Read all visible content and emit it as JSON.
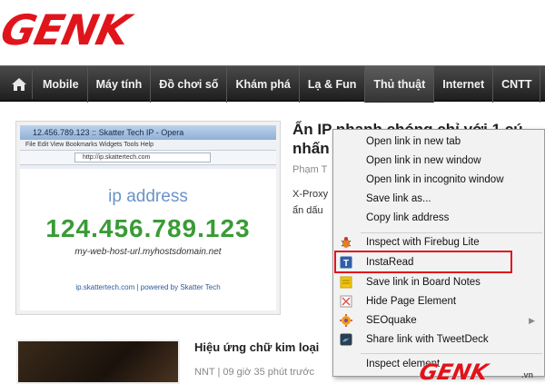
{
  "logo": {
    "text": "GENK"
  },
  "nav": {
    "items": [
      "Mobile",
      "Máy tính",
      "Đồ chơi số",
      "Khám phá",
      "Lạ & Fun",
      "Thủ thuật",
      "Internet",
      "CNTT"
    ],
    "active": "Thủ thuật"
  },
  "article1": {
    "thumb": {
      "window_title": "12.456.789.123 :: Skatter Tech IP - Opera",
      "menu": "File   Edit   View   Bookmarks   Widgets   Tools   Help",
      "address": "http://ip.skattertech.com",
      "label": "ip address",
      "ip": "124.456.789.123",
      "host": "my-web-host-url.myhostsdomain.net",
      "powered": "ip.skattertech.com  |  powered by Skatter Tech"
    },
    "title_line1": "Ẩn IP nhanh chóng chỉ với 1 cú",
    "title_line2": "nhấn",
    "meta": "Phạm T",
    "body_line1": "X-Proxy",
    "body_line2": "ẩn dấu"
  },
  "article2": {
    "title": "Hiệu ứng chữ kim loại",
    "meta": "NNT | 09 giờ 35 phút trước"
  },
  "context_menu": {
    "items": [
      {
        "label": "Open link in new tab",
        "icon": ""
      },
      {
        "label": "Open link in new window",
        "icon": ""
      },
      {
        "label": "Open link in incognito window",
        "icon": ""
      },
      {
        "label": "Save link as...",
        "icon": ""
      },
      {
        "label": "Copy link address",
        "icon": ""
      },
      {
        "label": "Inspect with Firebug Lite",
        "icon": "firebug-icon"
      },
      {
        "label": "InstaRead",
        "icon": "instaread-icon"
      },
      {
        "label": "Save link in Board Notes",
        "icon": "board-notes-icon"
      },
      {
        "label": "Hide Page Element",
        "icon": "hide-element-icon"
      },
      {
        "label": "SEOquake",
        "icon": "seoquake-icon",
        "submenu": true
      },
      {
        "label": "Share link with TweetDeck",
        "icon": "tweetdeck-icon"
      },
      {
        "label": "Inspect element",
        "icon": ""
      }
    ],
    "highlighted": "InstaRead",
    "highlight_color": "#e0141b"
  },
  "watermark": {
    "text": "GENK",
    "suffix": ".vn"
  },
  "colors": {
    "brand": "#e0141b",
    "nav": "#2b2b2b",
    "ip_green": "#3a9b36"
  }
}
